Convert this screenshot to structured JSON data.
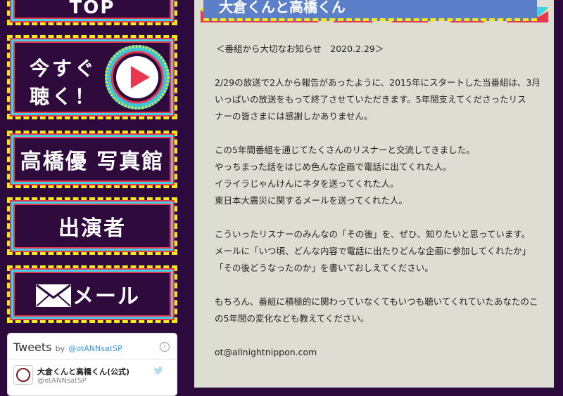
{
  "menu": {
    "top_label": "TOP",
    "listen_line1": "今すぐ",
    "listen_line2": "聴く！",
    "photo_label": "高橋優 写真館",
    "cast_label": "出演者",
    "mail_label": "メール"
  },
  "twitter": {
    "title": "Tweets",
    "by": "by",
    "handle": "@otANNsatSP",
    "tweet_name": "大倉くんと高橋くん(公式)",
    "tweet_user": "@otANNsatSP",
    "info_glyph": "i"
  },
  "banner": {
    "title": "大倉くんと高橋くん"
  },
  "article": {
    "notice": "＜番組から大切なお知らせ　2020.2.29＞",
    "para1_line1": "2/29の放送で2人から報告があったように、2015年にスタートした当番組は、3月",
    "para1_line2": "いっぱいの放送をもって終了させていただきます。5年間支えてくださったリス",
    "para1_line3": "ナーの皆さまには感謝しかありません。",
    "para2_line1": "この5年間番組を通じてたくさんのリスナーと交流してきました。",
    "para2_line2": "やっちまった話をはじめ色んな企画で電話に出てくれた人。",
    "para2_line3": "イライラじゃんけんにネタを送ってくれた人。",
    "para2_line4": "東日本大震災に関するメールを送ってくれた人。",
    "para3_line1": "こういったリスナーのみんなの「その後」を、ぜひ、知りたいと思っています。",
    "para3_line2": "メールに「いつ頃、どんな内容で電話に出たりどんな企画に参加してくれたか」",
    "para3_line3": "「その後どうなったのか」を書いておしえてください。",
    "para4_line1": "もちろん、番組に積極的に関わっていなくてもいつも聴いてくれていたあなたのこ",
    "para4_line2": "の5年間の変化なども教えてください。",
    "email": "ot@allnightnippon.com"
  },
  "colors": {
    "background": "#2d0a3d",
    "panel": "#ddddd3",
    "banner": "#5b7fc9",
    "frame_yellow": "#f7e81a",
    "frame_cyan": "#3fd2e6",
    "frame_red": "#e8384f",
    "play_red": "#e8384f"
  },
  "icons": {
    "play": "play-icon",
    "mail": "mail-icon",
    "twitter": "twitter-bird-icon",
    "info": "info-icon"
  }
}
